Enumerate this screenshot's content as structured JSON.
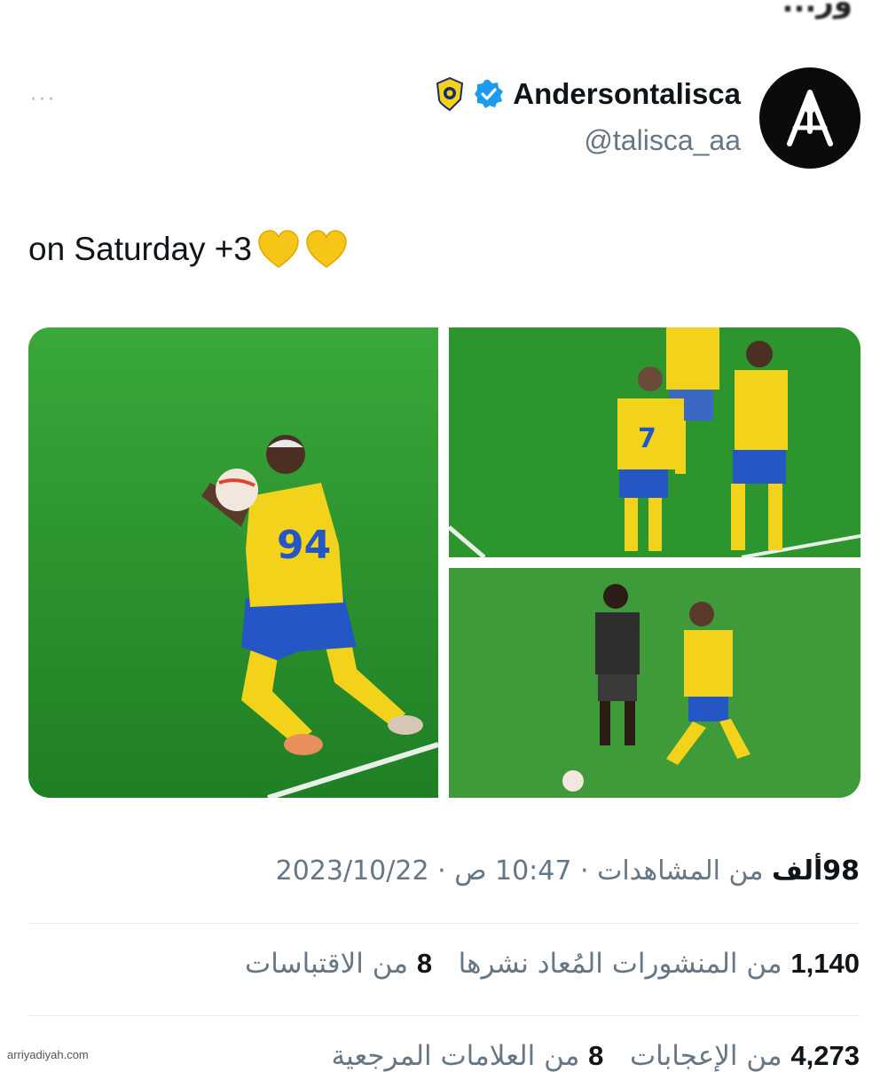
{
  "header": {
    "top_cut_text": "...ور"
  },
  "tweet": {
    "display_name": "Andersontalisca",
    "handle": "@talisca_aa",
    "text": "on Saturday +3",
    "more_label": "···",
    "jersey_numbers": [
      "94",
      "7"
    ]
  },
  "meta": {
    "date": "2023/10/22",
    "time": "10:47 ص",
    "views_count": "98ألف",
    "views_label": "من المشاهدات",
    "separator": "·"
  },
  "stats_row1": {
    "reposts_count": "1,140",
    "reposts_label": "من المنشورات المُعاد نشرها",
    "quotes_count": "8",
    "quotes_label": "من الاقتباسات"
  },
  "stats_row2": {
    "likes_count": "4,273",
    "likes_label": "من الإعجابات",
    "bookmarks_count": "8",
    "bookmarks_label": "من العلامات المرجعية"
  },
  "watermark": "arriyadiyah.com",
  "colors": {
    "verified": "#1d9bf0",
    "heart": "#f5c518",
    "pitch": "#2f9a2f",
    "kit_yellow": "#f2d21a",
    "kit_blue": "#2457c5"
  },
  "icons": {
    "more": "more-horizontal-icon",
    "verified": "verified-badge-icon",
    "club": "club-badge-icon",
    "heart": "yellow-heart-icon"
  }
}
